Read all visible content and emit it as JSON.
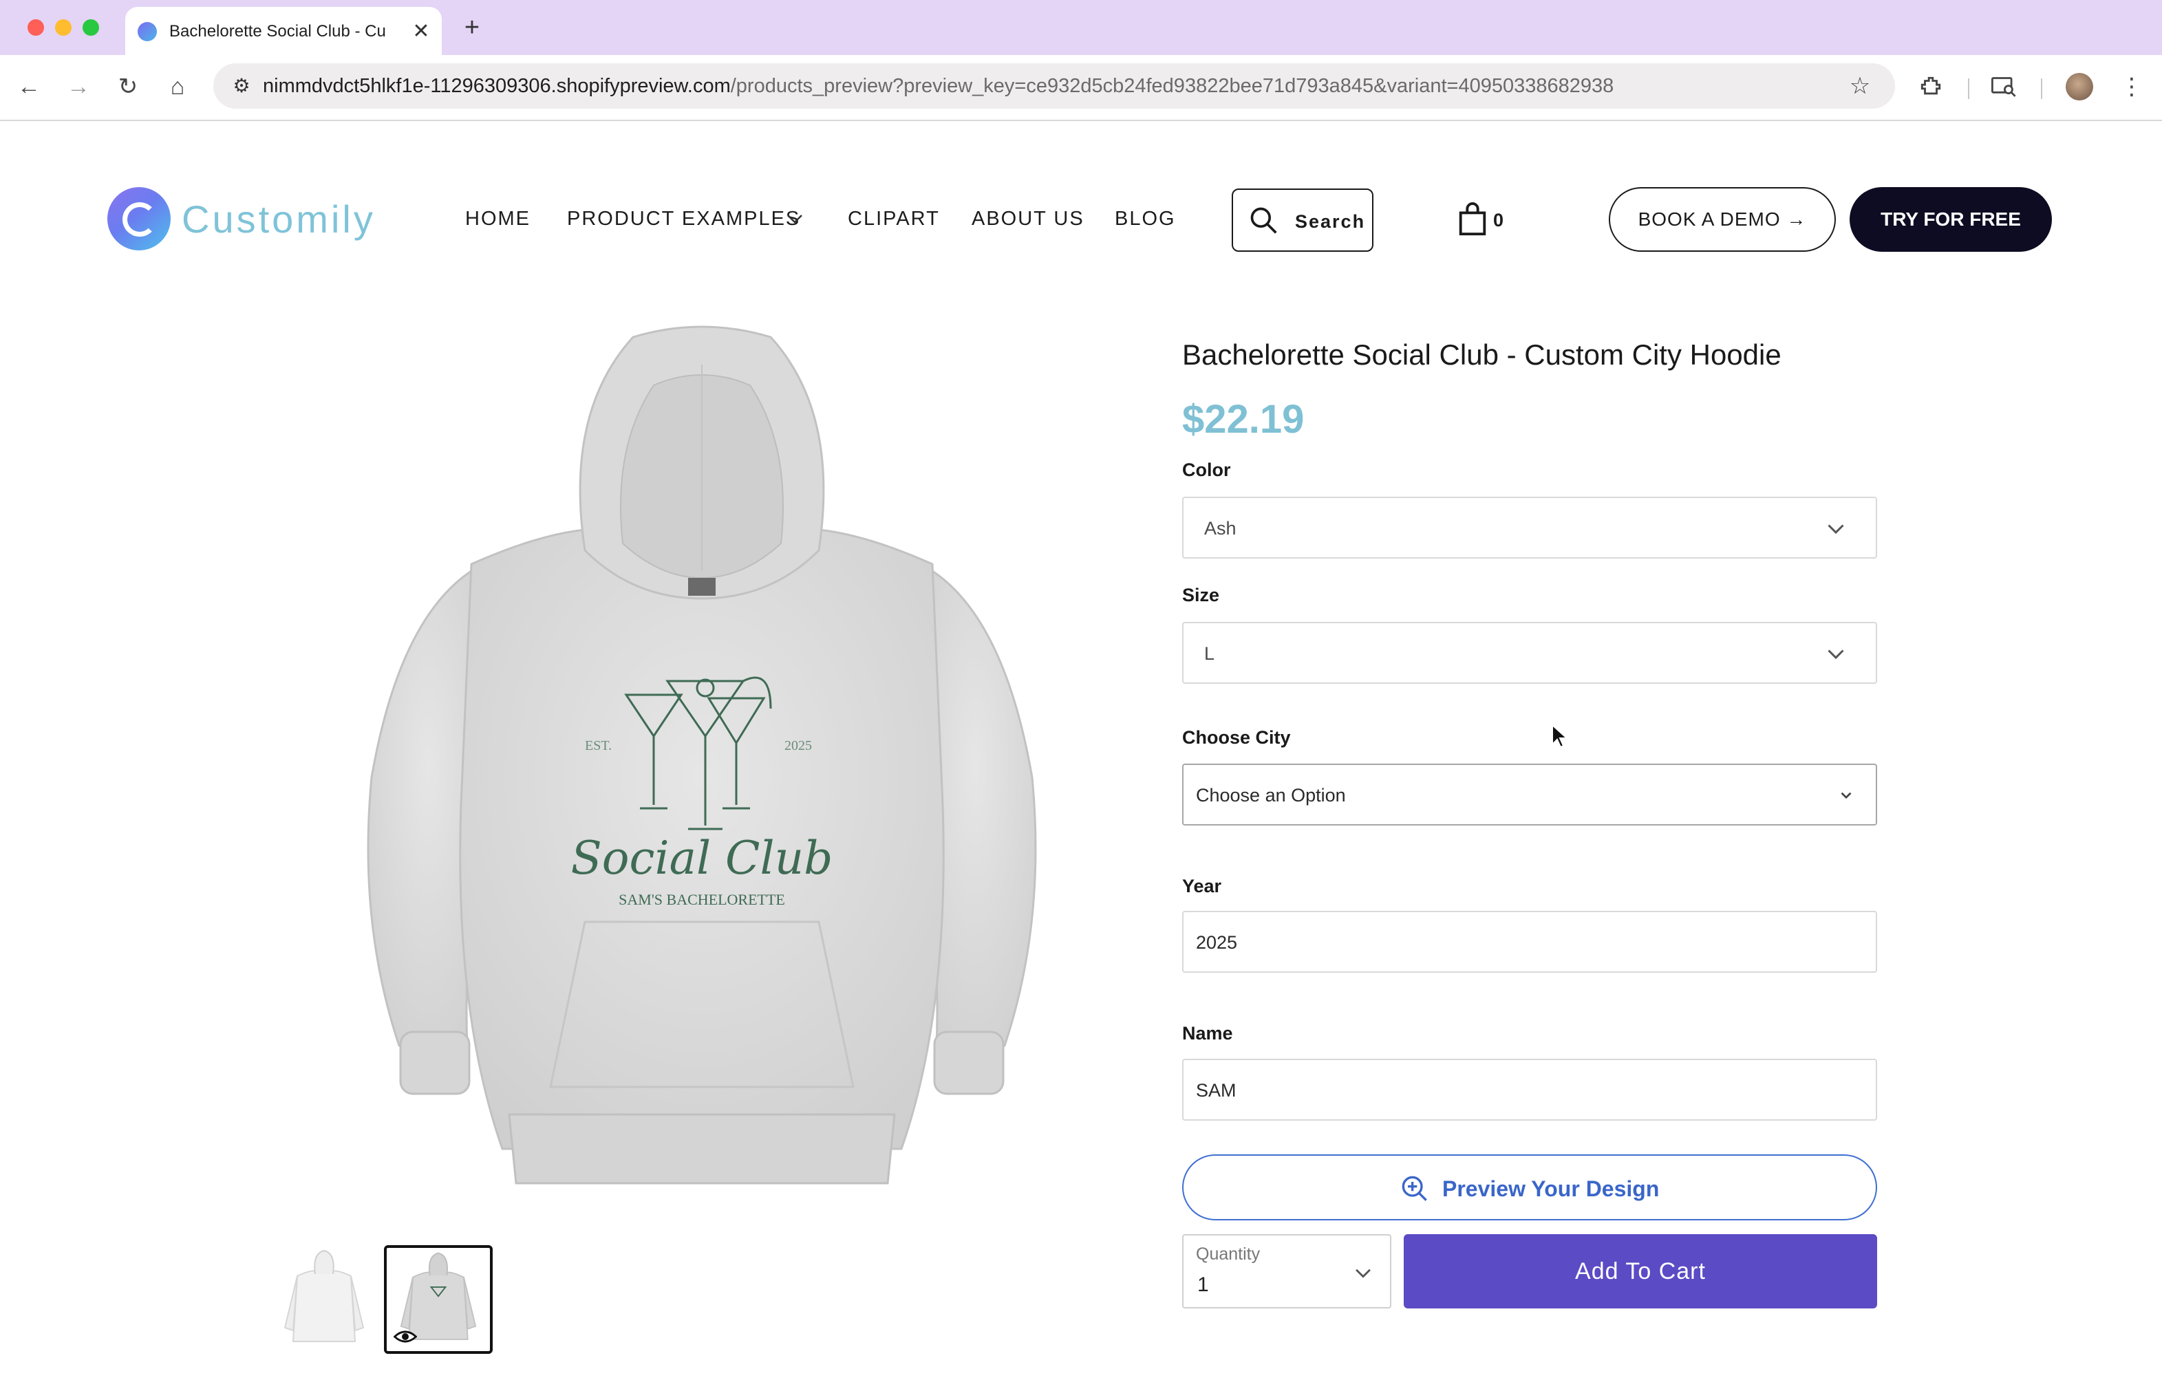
{
  "browser": {
    "tab_title": "Bachelorette Social Club - Cu",
    "url_host": "nimmdvdct5hlkf1e-11296309306.shopifypreview.com",
    "url_path": "/products_preview?preview_key=ce932d5cb24fed93822bee71d793a845&variant=40950338682938",
    "tabbar_color": "#e4d4f6"
  },
  "site": {
    "logo_text": "Customily",
    "nav": {
      "home": "HOME",
      "product_examples": "PRODUCT EXAMPLES",
      "clipart": "CLIPART",
      "about": "ABOUT US",
      "blog": "BLOG"
    },
    "search_label": "Search",
    "cart_count": "0",
    "book_demo": "BOOK A DEMO →",
    "try_free": "TRY FOR FREE"
  },
  "product": {
    "title": "Bachelorette Social Club - Custom City Hoodie",
    "price": "$22.19",
    "price_color": "#7fc0d4",
    "print": {
      "est": "EST.",
      "year": "2025",
      "headline": "Social Club",
      "subline": "SAM'S BACHELORETTE"
    },
    "options": {
      "color_label": "Color",
      "color_value": "Ash",
      "size_label": "Size",
      "size_value": "L",
      "city_label": "Choose City",
      "city_value": "Choose an Option",
      "year_label": "Year",
      "year_value": "2025",
      "name_label": "Name",
      "name_value": "SAM"
    },
    "preview_label": "Preview Your Design",
    "quantity_label": "Quantity",
    "quantity_value": "1",
    "add_to_cart": "Add To Cart",
    "accent_color": "#5b4bc4"
  }
}
